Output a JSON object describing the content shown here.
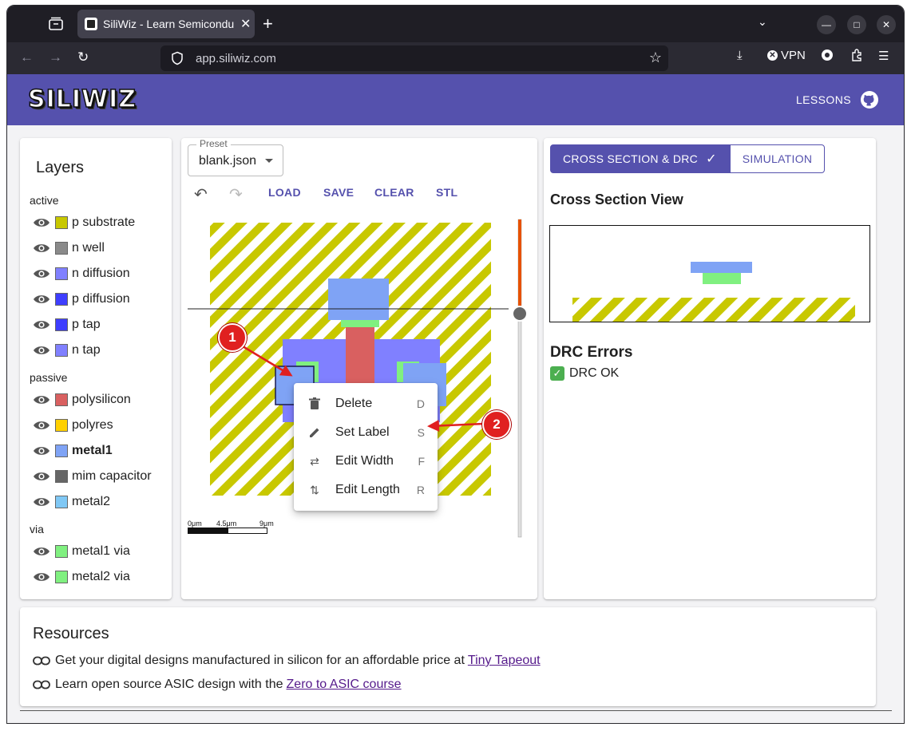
{
  "browser": {
    "tab_title": "SiliWiz - Learn Semiconductor",
    "tab_close": "✕",
    "new_tab": "+",
    "url": "app.siliwiz.com",
    "vpn_label": "VPN",
    "minimize": "—",
    "maximize": "□",
    "close": "✕"
  },
  "app": {
    "logo": "SILIWIZ",
    "lessons": "LESSONS"
  },
  "layers_panel": {
    "title": "Layers",
    "groups": [
      {
        "label": "active",
        "layers": [
          {
            "name": "p substrate",
            "color": "#c8c800"
          },
          {
            "name": "n well",
            "color": "#8a8a8a"
          },
          {
            "name": "n diffusion",
            "color": "#8080ff"
          },
          {
            "name": "p diffusion",
            "color": "#3e3eff"
          },
          {
            "name": "p tap",
            "color": "#3e3eff"
          },
          {
            "name": "n tap",
            "color": "#8080ff"
          }
        ]
      },
      {
        "label": "passive",
        "layers": [
          {
            "name": "polysilicon",
            "color": "#d96060"
          },
          {
            "name": "polyres",
            "color": "#ffd000"
          },
          {
            "name": "metal1",
            "color": "#7fa3f5",
            "bold": true
          },
          {
            "name": "mim capacitor",
            "color": "#666666"
          },
          {
            "name": "metal2",
            "color": "#80c8f5"
          }
        ]
      },
      {
        "label": "via",
        "layers": [
          {
            "name": "metal1 via",
            "color": "#80f080"
          },
          {
            "name": "metal2 via",
            "color": "#80f080"
          }
        ]
      }
    ]
  },
  "editor": {
    "preset_label": "Preset",
    "preset_value": "blank.json",
    "buttons": {
      "load": "LOAD",
      "save": "SAVE",
      "clear": "CLEAR",
      "stl": "STL"
    },
    "scale": {
      "s0": "0μm",
      "s1": "4.5μm",
      "s2": "9μm"
    },
    "context_menu": [
      {
        "label": "Delete",
        "key": "D",
        "icon": "trash-icon"
      },
      {
        "label": "Set Label",
        "key": "S",
        "icon": "pencil-icon"
      },
      {
        "label": "Edit Width",
        "key": "F",
        "icon": "swap-horizontal-icon"
      },
      {
        "label": "Edit Length",
        "key": "R",
        "icon": "swap-vertical-icon"
      }
    ]
  },
  "right_panel": {
    "tab_cross": "CROSS SECTION & DRC",
    "tab_sim": "SIMULATION",
    "cross_title": "Cross Section View",
    "drc_title": "DRC Errors",
    "drc_status": "DRC OK"
  },
  "resources": {
    "title": "Resources",
    "line1_text": "Get your digital designs manufactured in silicon for an affordable price at",
    "line1_link": "Tiny Tapeout",
    "line2_text": "Learn open source ASIC design with the",
    "line2_link": "Zero to ASIC course"
  },
  "annotations": {
    "m1": "1",
    "m2": "2"
  },
  "colors": {
    "accent": "#5551ad",
    "marker": "#e02020",
    "slider": "#e65100"
  }
}
